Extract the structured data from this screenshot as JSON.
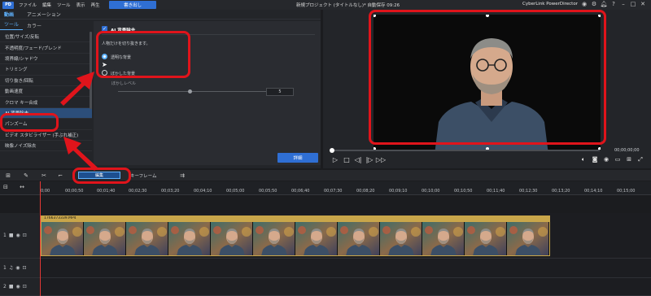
{
  "titlebar": {
    "menu": [
      "ファイル",
      "編集",
      "ツール",
      "表示",
      "再生"
    ],
    "export_label": "書き出し",
    "project_title": "新規プロジェクト (タイトルなし)* 自動保存 09:26",
    "brand": "CyberLink PowerDirector"
  },
  "left_panel": {
    "tab_video": "動画",
    "tab_animation": "アニメーション",
    "subtab_tools": "ツール",
    "subtab_color": "カラー",
    "tools": [
      "位置/サイズ/反転",
      "不透明度/フェード/ブレンド",
      "境界線/シャドウ",
      "トリミング",
      "切り抜き/回転",
      "動画速度",
      "クロマ キー合成",
      "AI 背景除去",
      "パンズーム",
      "ビデオ スタビライザー (手ぶれ補正)",
      "映像ノイズ除去"
    ],
    "active_tool_index": 7
  },
  "ai_panel": {
    "title": "AI 背景除去",
    "description": "人物だけを切り抜きます。",
    "option_transparent": "透明な背景",
    "option_blur": "ぼかした背景",
    "blur_level_label": "ぼかしレベル",
    "blur_value": "5",
    "detail_button": "詳細"
  },
  "preview": {
    "time": "00;00;00;00"
  },
  "timeline": {
    "edit_button": "編集",
    "keyframe_button": "キーフレーム",
    "ruler_ticks": [
      "0;00",
      "00;00;50",
      "00;01;40",
      "00;02;30",
      "00;03;20",
      "00;04;10",
      "00;05;00",
      "00;05;50",
      "00;06;40",
      "00;07;30",
      "00;08;20",
      "00;09;10",
      "00;10;00",
      "00;10;50",
      "00;11;40",
      "00;12;30",
      "00;13;20",
      "00;14;10",
      "00;15;00"
    ],
    "clip_label": "1766373339.MP4",
    "track_1": "1",
    "track_1a": "1",
    "track_2": "2"
  },
  "colors": {
    "accent": "#2f6fd4",
    "annotation_red": "#e0141b",
    "clip_gold": "#c9a64a"
  }
}
